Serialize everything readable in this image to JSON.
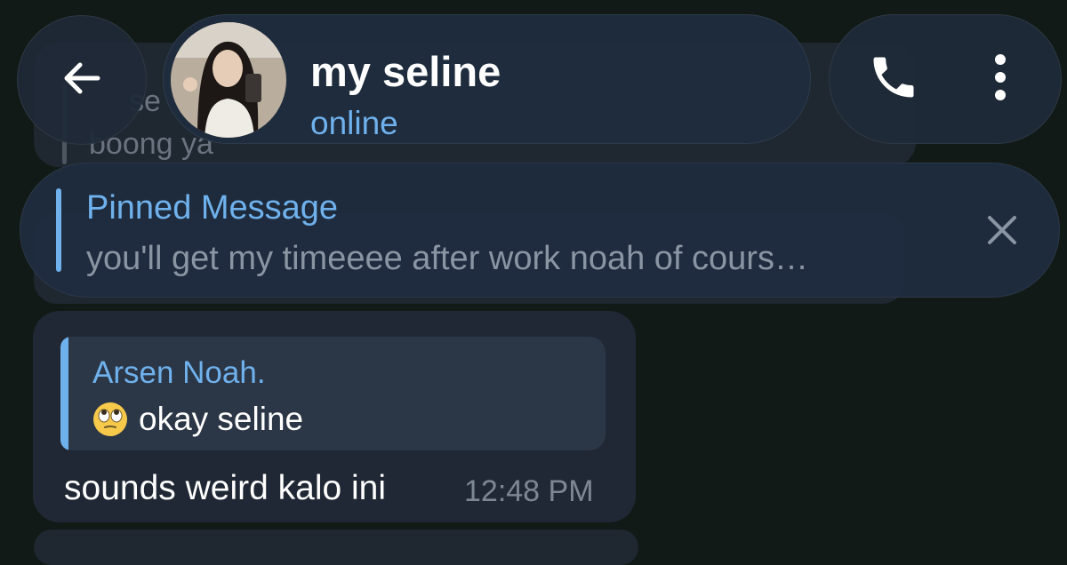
{
  "header": {
    "contact_name": "my seline",
    "status": "online"
  },
  "pinned": {
    "title": "Pinned Message",
    "text": "you'll get my timeeee after work noah of cours…"
  },
  "background_message": {
    "reply_name_fragment": "se",
    "reply_text_fragment": "boong ya"
  },
  "message": {
    "reply": {
      "name": "Arsen Noah.",
      "text": "okay seline",
      "emoji": "face-with-rolling-eyes-icon"
    },
    "text": "sounds weird kalo ini",
    "time": "12:48 PM"
  },
  "colors": {
    "background": "#121a17",
    "panel": "#1f2c3e",
    "accent": "#6fb1ec",
    "bubble": "#202835",
    "quote_bg": "#2b3646",
    "secondary_text": "#8a95a3"
  }
}
